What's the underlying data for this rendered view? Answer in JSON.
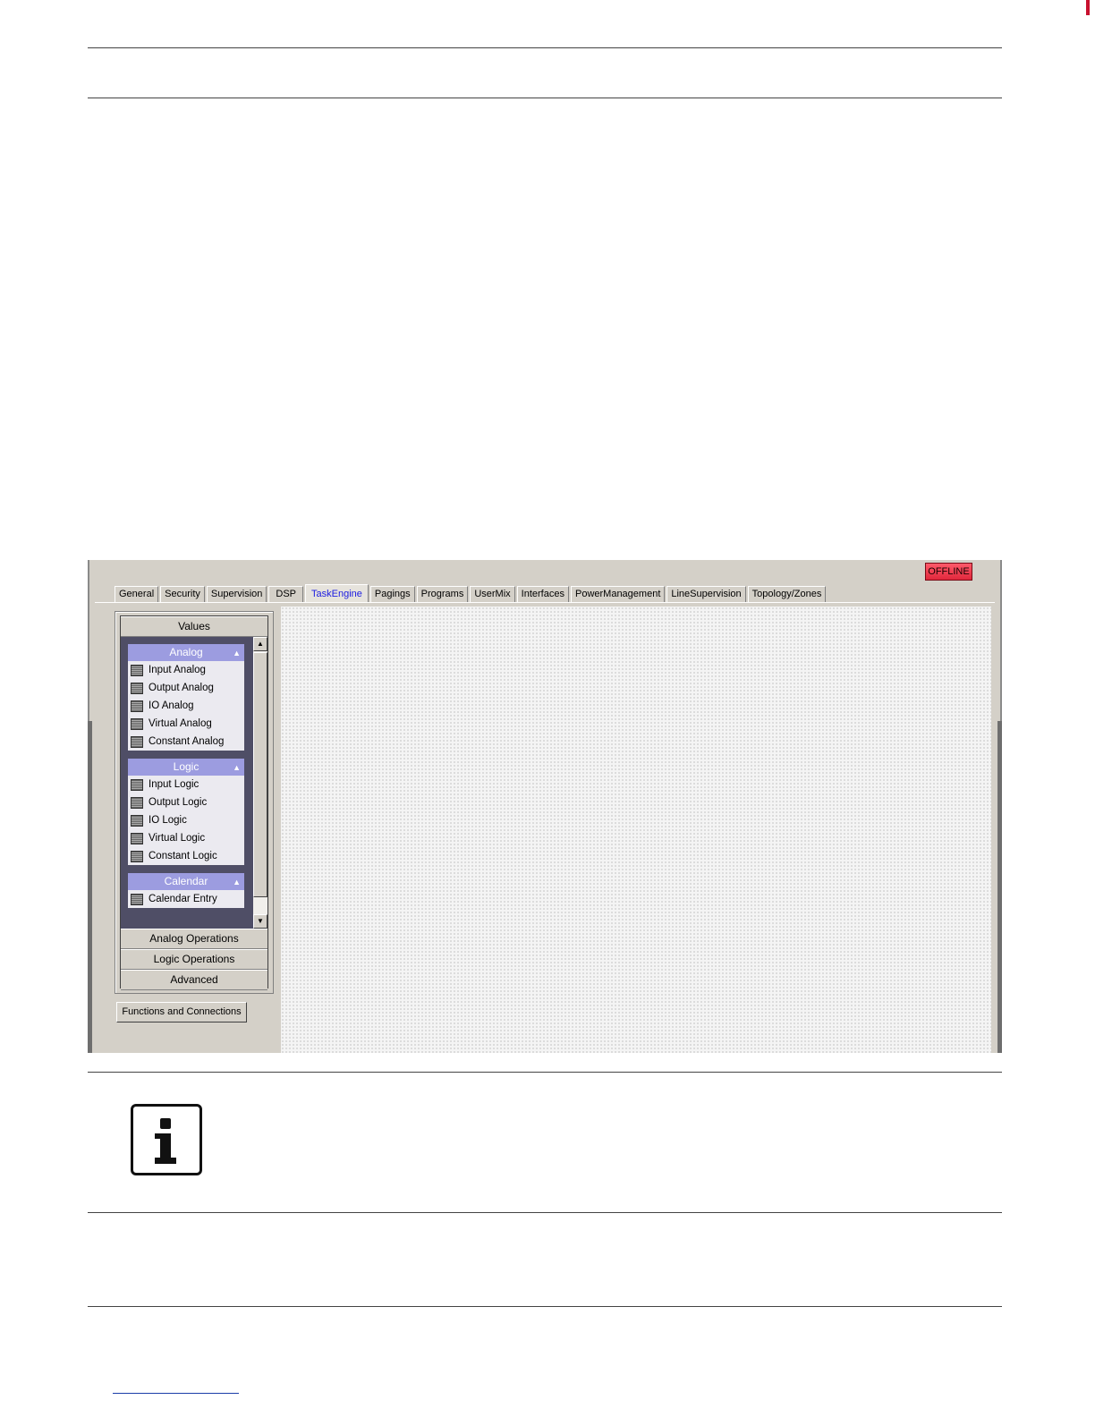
{
  "document": {
    "brand_color": "#c8102e",
    "link_color": "#1a3da8"
  },
  "window": {
    "status_badge": "OFFLINE",
    "status_color": "#e0283c",
    "tabs": [
      {
        "label": "General"
      },
      {
        "label": "Security"
      },
      {
        "label": "Supervision"
      },
      {
        "label": "DSP"
      },
      {
        "label": "TaskEngine",
        "active": true
      },
      {
        "label": "Pagings"
      },
      {
        "label": "Programs"
      },
      {
        "label": "UserMix"
      },
      {
        "label": "Interfaces"
      },
      {
        "label": "PowerManagement"
      },
      {
        "label": "LineSupervision"
      },
      {
        "label": "Topology/Zones"
      }
    ],
    "sidebar": {
      "sections": {
        "values": "Values",
        "analog_operations": "Analog Operations",
        "logic_operations": "Logic Operations",
        "advanced": "Advanced"
      },
      "groups": {
        "analog": {
          "title": "Analog",
          "items": [
            "Input Analog",
            "Output Analog",
            "IO Analog",
            "Virtual Analog",
            "Constant Analog"
          ]
        },
        "logic": {
          "title": "Logic",
          "items": [
            "Input Logic",
            "Output Logic",
            "IO Logic",
            "Virtual Logic",
            "Constant Logic"
          ]
        },
        "calendar": {
          "title": "Calendar",
          "items": [
            "Calendar Entry"
          ]
        }
      }
    },
    "functions_button": "Functions and Connections"
  }
}
